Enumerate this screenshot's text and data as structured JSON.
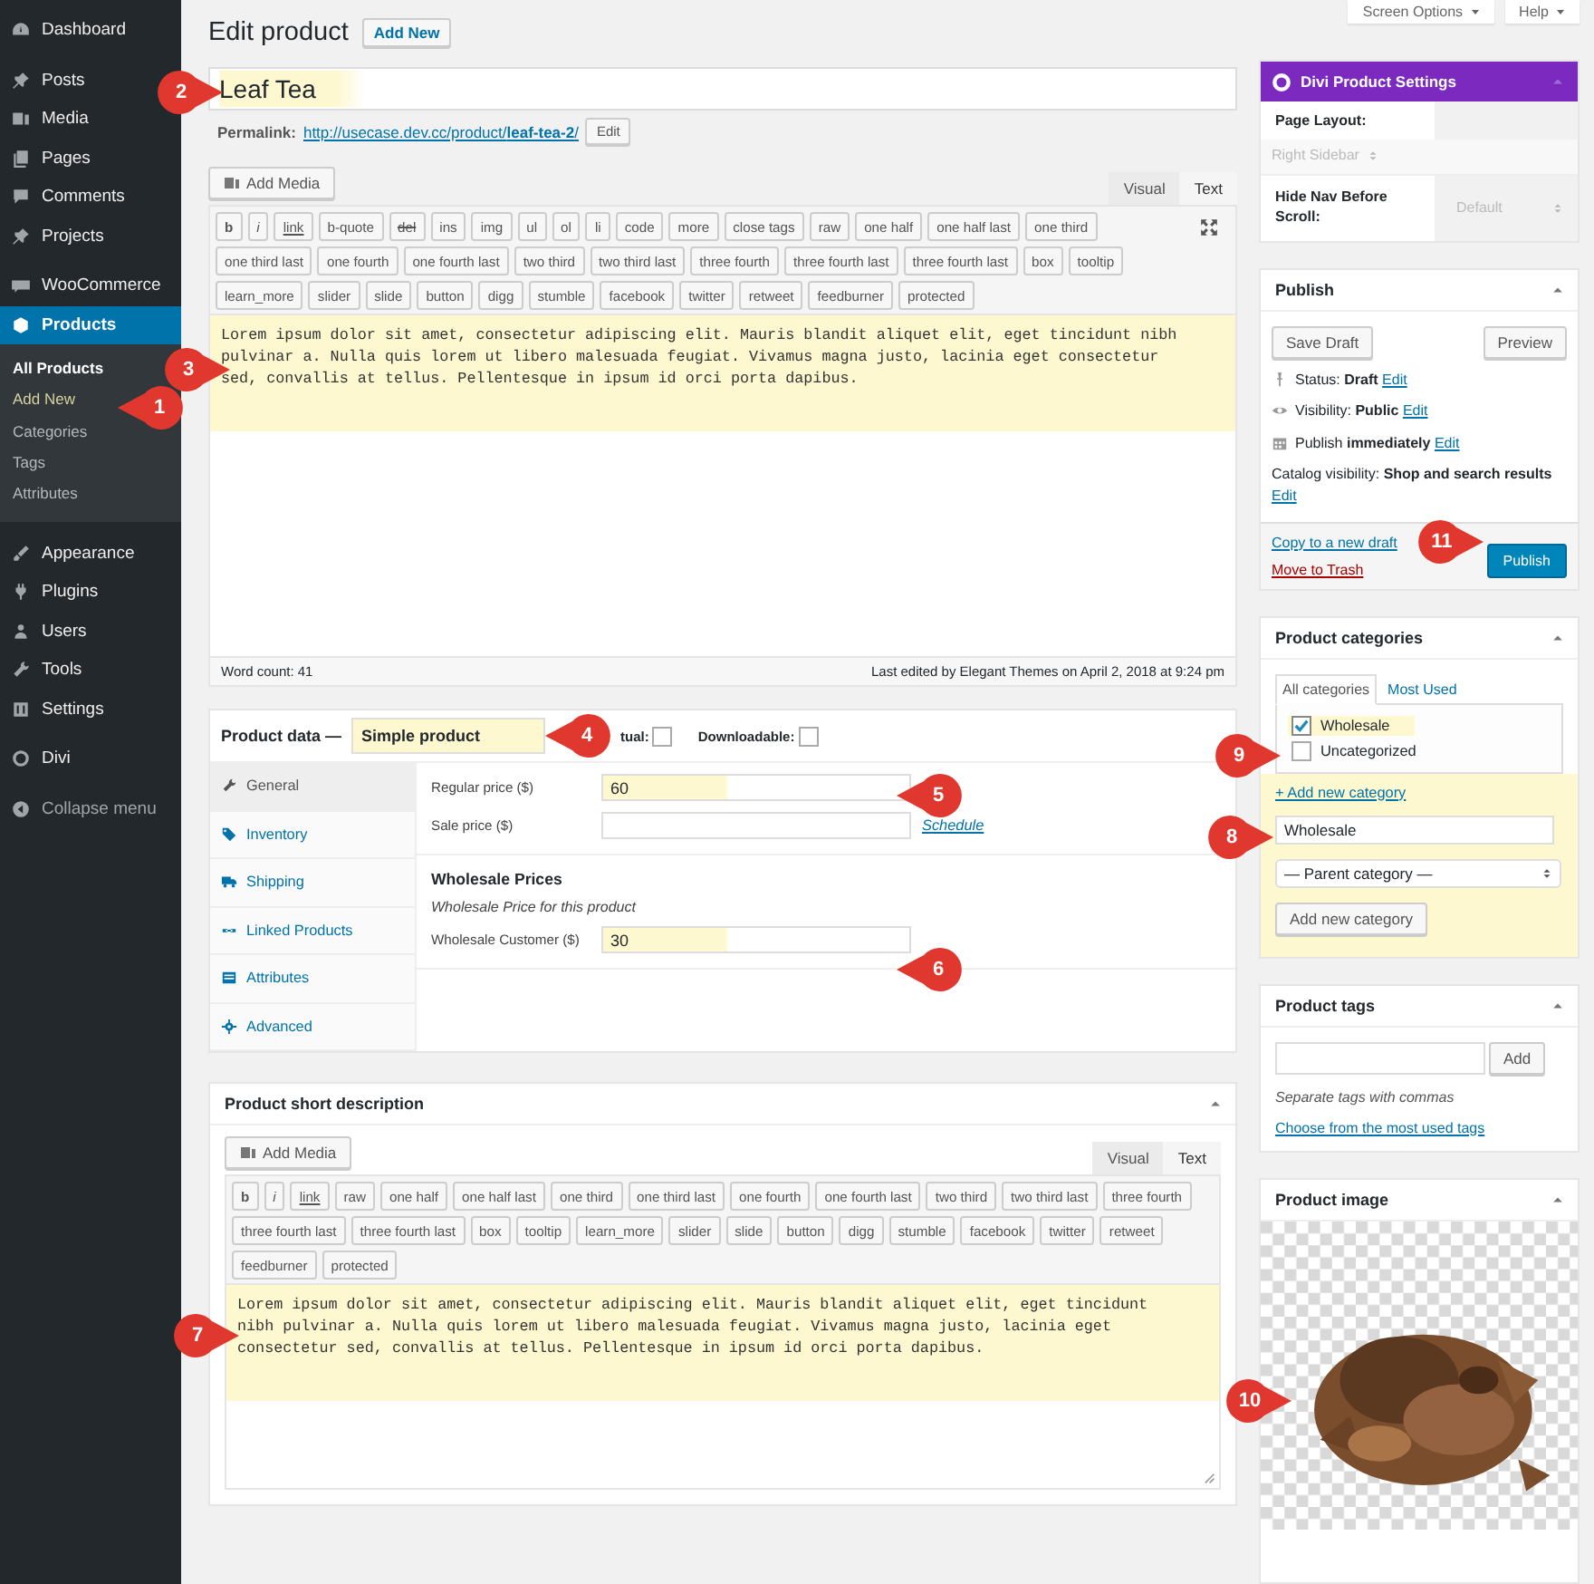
{
  "sidebar": {
    "menu_groups": [
      [
        {
          "label": "Dashboard",
          "selected": false
        }
      ],
      [
        {
          "label": "Posts",
          "selected": false
        },
        {
          "label": "Media",
          "selected": false
        },
        {
          "label": "Pages",
          "selected": false
        },
        {
          "label": "Comments",
          "selected": false
        },
        {
          "label": "Projects",
          "selected": false
        }
      ],
      [
        {
          "label": "WooCommerce",
          "selected": false
        },
        {
          "label": "Products",
          "selected": true,
          "children": [
            {
              "label": "All Products",
              "selected": true,
              "hovered": false
            },
            {
              "label": "Add New",
              "selected": false,
              "hovered": true
            },
            {
              "label": "Categories",
              "selected": false,
              "hovered": false
            },
            {
              "label": "Tags",
              "selected": false,
              "hovered": false
            },
            {
              "label": "Attributes",
              "selected": false,
              "hovered": false
            }
          ]
        }
      ],
      [
        {
          "label": "Appearance",
          "selected": false
        },
        {
          "label": "Plugins",
          "selected": false
        },
        {
          "label": "Users",
          "selected": false
        },
        {
          "label": "Tools",
          "selected": false
        },
        {
          "label": "Settings",
          "selected": false
        }
      ],
      [
        {
          "label": "Divi",
          "selected": false
        }
      ]
    ],
    "collapse_button": "Collapse menu"
  },
  "top_buttons": [
    "Screen Options",
    "Help"
  ],
  "page_title": "Edit product",
  "add_new": "Add New",
  "post_title": {
    "value": "Leaf Tea",
    "highlighted": true
  },
  "permalink": {
    "label": "Permalink:",
    "url": "http://usecase.dev.cc/product/**leaf-tea-2**/",
    "edit": "Edit"
  },
  "editor": {
    "add_media": "Add Media",
    "tabs": [
      {
        "label": "Visual",
        "selected": false
      },
      {
        "label": "Text",
        "selected": true
      }
    ],
    "quicktags": [
      {
        "label": "b",
        "kind": "bold"
      },
      {
        "label": "i",
        "kind": "italic"
      },
      {
        "label": "link",
        "kind": "link"
      },
      {
        "label": "b-quote",
        "kind": "plain"
      },
      {
        "label": "del",
        "kind": "strike"
      },
      {
        "label": "ins",
        "kind": "plain"
      },
      {
        "label": "img",
        "kind": "plain"
      },
      {
        "label": "ul",
        "kind": "plain"
      },
      {
        "label": "ol",
        "kind": "plain"
      },
      {
        "label": "li",
        "kind": "plain"
      },
      {
        "label": "code",
        "kind": "plain"
      },
      {
        "label": "more",
        "kind": "plain"
      },
      {
        "label": "close tags",
        "kind": "plain"
      },
      {
        "label": "raw",
        "kind": "plain"
      },
      {
        "label": "one half",
        "kind": "plain"
      },
      {
        "label": "one half last",
        "kind": "plain"
      },
      {
        "label": "one third",
        "kind": "plain"
      },
      {
        "label": "one third last",
        "kind": "plain"
      },
      {
        "label": "one fourth",
        "kind": "plain"
      },
      {
        "label": "one fourth last",
        "kind": "plain"
      },
      {
        "label": "two third",
        "kind": "plain"
      },
      {
        "label": "two third last",
        "kind": "plain"
      },
      {
        "label": "three fourth",
        "kind": "plain"
      },
      {
        "label": "three fourth last",
        "kind": "plain"
      },
      {
        "label": "three fourth last",
        "kind": "plain"
      },
      {
        "label": "box",
        "kind": "plain"
      },
      {
        "label": "tooltip",
        "kind": "plain"
      },
      {
        "label": "learn_more",
        "kind": "plain"
      },
      {
        "label": "slider",
        "kind": "plain"
      },
      {
        "label": "slide",
        "kind": "plain"
      },
      {
        "label": "button",
        "kind": "plain"
      },
      {
        "label": "digg",
        "kind": "plain"
      },
      {
        "label": "stumble",
        "kind": "plain"
      },
      {
        "label": "facebook",
        "kind": "plain"
      },
      {
        "label": "twitter",
        "kind": "plain"
      },
      {
        "label": "retweet",
        "kind": "plain"
      },
      {
        "label": "feedburner",
        "kind": "plain"
      },
      {
        "label": "protected",
        "kind": "plain"
      }
    ],
    "content": "Lorem ipsum dolor sit amet, consectetur adipiscing elit. Mauris blandit aliquet elit, eget tincidunt nibh pulvinar a. Nulla quis lorem ut libero malesuada feugiat. Vivamus magna justo, lacinia eget consectetur sed, convallis at tellus. Pellentesque in ipsum id orci porta dapibus.",
    "highlighted": true,
    "word_count": "Word count: 41",
    "last_edited": "Last edited by Elegant Themes on April 2, 2018 at 9:24 pm"
  },
  "product_data": {
    "title": "Product data —",
    "type": {
      "value": "Simple product",
      "highlighted": true
    },
    "checkboxes": [
      {
        "label": "tual:",
        "checked": false
      },
      {
        "label": "Downloadable:",
        "checked": false
      }
    ],
    "tabs": [
      {
        "label": "General",
        "selected": true
      },
      {
        "label": "Inventory",
        "selected": false
      },
      {
        "label": "Shipping",
        "selected": false
      },
      {
        "label": "Linked Products",
        "selected": false
      },
      {
        "label": "Attributes",
        "selected": false
      },
      {
        "label": "Advanced",
        "selected": false
      }
    ],
    "fields": [
      {
        "label": "Regular price ($)",
        "value": "60",
        "highlighted": true
      },
      {
        "label": "Sale price ($)",
        "highlighted": false,
        "link": "Schedule"
      }
    ],
    "wholesale": {
      "heading": "Wholesale Prices",
      "note": "Wholesale Price for this product",
      "fields": [
        {
          "label": "Wholesale Customer ($)",
          "value": "30",
          "highlighted": true
        }
      ]
    }
  },
  "short_description": {
    "title": "Product short description",
    "add_media": "Add Media",
    "tabs": [
      {
        "label": "Visual",
        "selected": false
      },
      {
        "label": "Text",
        "selected": true
      }
    ],
    "quicktags": [
      {
        "label": "b",
        "kind": "bold"
      },
      {
        "label": "i",
        "kind": "italic"
      },
      {
        "label": "link",
        "kind": "link"
      },
      {
        "label": "raw",
        "kind": "plain"
      },
      {
        "label": "one half",
        "kind": "plain"
      },
      {
        "label": "one half last",
        "kind": "plain"
      },
      {
        "label": "one third",
        "kind": "plain"
      },
      {
        "label": "one third last",
        "kind": "plain"
      },
      {
        "label": "one fourth",
        "kind": "plain"
      },
      {
        "label": "one fourth last",
        "kind": "plain"
      },
      {
        "label": "two third",
        "kind": "plain"
      },
      {
        "label": "two third last",
        "kind": "plain"
      },
      {
        "label": "three fourth",
        "kind": "plain"
      },
      {
        "label": "three fourth last",
        "kind": "plain"
      },
      {
        "label": "three fourth last",
        "kind": "plain"
      },
      {
        "label": "box",
        "kind": "plain"
      },
      {
        "label": "tooltip",
        "kind": "plain"
      },
      {
        "label": "learn_more",
        "kind": "plain"
      },
      {
        "label": "slider",
        "kind": "plain"
      },
      {
        "label": "slide",
        "kind": "plain"
      },
      {
        "label": "button",
        "kind": "plain"
      },
      {
        "label": "digg",
        "kind": "plain"
      },
      {
        "label": "stumble",
        "kind": "plain"
      },
      {
        "label": "facebook",
        "kind": "plain"
      },
      {
        "label": "twitter",
        "kind": "plain"
      },
      {
        "label": "retweet",
        "kind": "plain"
      },
      {
        "label": "feedburner",
        "kind": "plain"
      },
      {
        "label": "protected",
        "kind": "plain"
      }
    ],
    "content": "Lorem ipsum dolor sit amet, consectetur adipiscing elit. Mauris blandit aliquet elit, eget tincidunt nibh pulvinar a. Nulla quis lorem ut libero malesuada feugiat. Vivamus magna justo, lacinia eget consectetur sed, convallis at tellus. Pellentesque in ipsum id orci porta dapibus.",
    "highlighted": true
  },
  "divi_settings": {
    "title": "Divi Product Settings",
    "fields": [
      {
        "label": "Page Layout:",
        "value": "Right Sidebar",
        "disabled": true
      },
      {
        "label": "Hide Nav Before Scroll:",
        "value": "Default",
        "disabled": true
      }
    ]
  },
  "publish": {
    "title": "Publish",
    "save_draft": "Save Draft",
    "preview": "Preview",
    "meta": [
      {
        "text": "Status: **Draft**",
        "edit": "Edit"
      },
      {
        "text": "Visibility: **Public**",
        "edit": "Edit"
      },
      {
        "text": "Publish **immediately**",
        "edit": "Edit"
      },
      {
        "text": "Catalog visibility: **Shop and search results**",
        "edit": "Edit"
      }
    ],
    "copy_link": "Copy to a new draft",
    "trash_link": "Move to Trash",
    "publish_button": "Publish"
  },
  "categories": {
    "title": "Product categories",
    "tabs": [
      {
        "label": "All categories",
        "selected": true
      },
      {
        "label": "Most Used",
        "selected": false
      }
    ],
    "items": [
      {
        "label": "Wholesale",
        "checked": true,
        "highlighted": true
      },
      {
        "label": "Uncategorized",
        "checked": false,
        "highlighted": false
      }
    ],
    "add_link": "+ Add new category",
    "new_name": "Wholesale",
    "parent": "— Parent category —",
    "add_button": "Add new category",
    "highlighted": true
  },
  "tags": {
    "title": "Product tags",
    "add": "Add",
    "hint": "Separate tags with commas",
    "choose": "Choose from the most used tags"
  },
  "product_image": {
    "title": "Product image",
    "kind": "picture"
  },
  "callouts": [
    {
      "number": "1"
    },
    {
      "number": "2"
    },
    {
      "number": "3"
    },
    {
      "number": "4"
    },
    {
      "number": "5"
    },
    {
      "number": "6"
    },
    {
      "number": "7"
    },
    {
      "number": "8"
    },
    {
      "number": "9"
    },
    {
      "number": "10"
    },
    {
      "number": "11"
    }
  ]
}
